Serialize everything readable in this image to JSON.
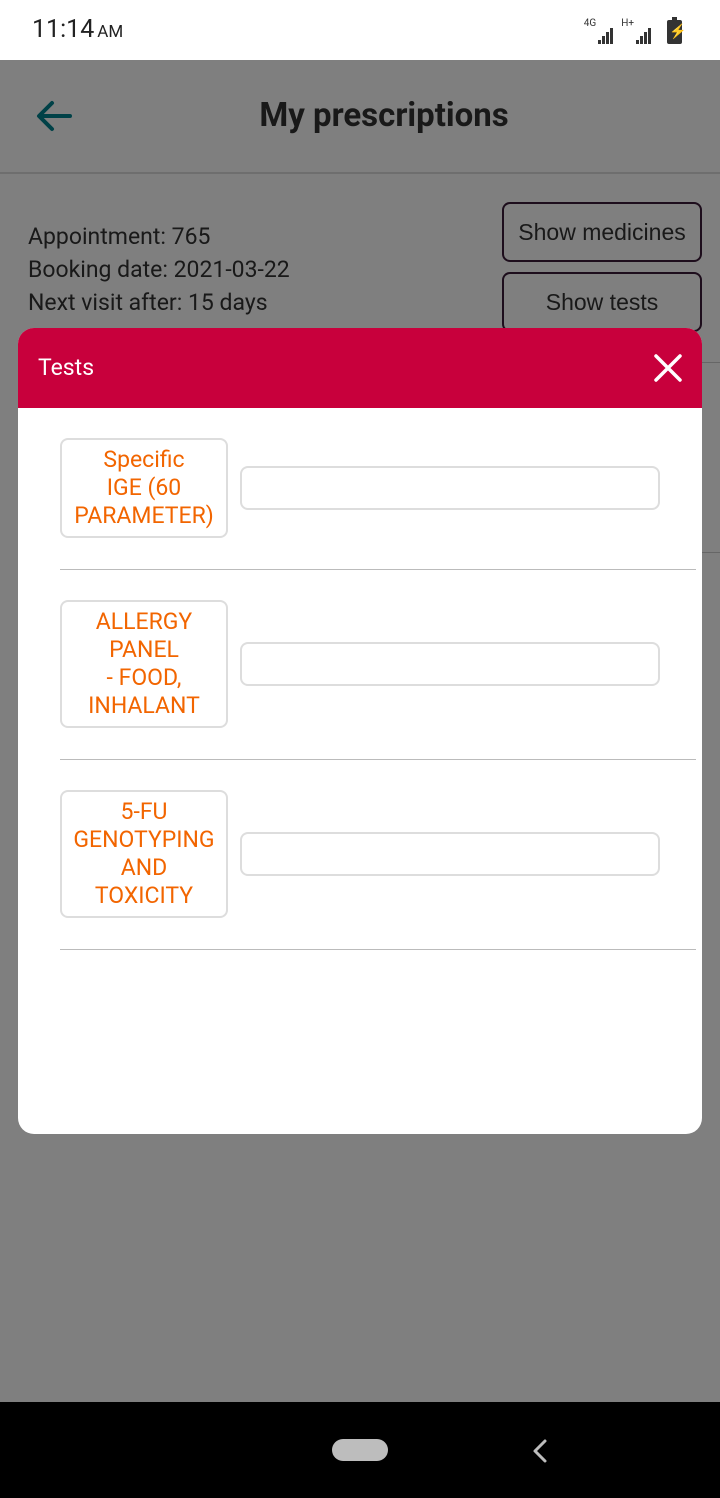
{
  "status_bar": {
    "time": "11:14",
    "ampm": "AM",
    "network_1": "4G",
    "network_2": "H+",
    "icons": [
      "signal-icon",
      "signal-icon",
      "battery-charging-icon"
    ]
  },
  "header": {
    "title": "My prescriptions",
    "back_icon": "arrow-left-icon"
  },
  "appointment": {
    "appointment_line": "Appointment: 765",
    "booking_line": "Booking date: 2021-03-22",
    "next_visit_line": "Next visit after: 15 days"
  },
  "actions": {
    "show_medicines": "Show medicines",
    "show_tests": "Show tests"
  },
  "dialog": {
    "title": "Tests",
    "close_icon": "close-icon",
    "tests": [
      {
        "name": "Specific\nIGE (60\nPARAMETER)",
        "value": ""
      },
      {
        "name": "ALLERGY\nPANEL\n- FOOD,\nINHALANT",
        "value": ""
      },
      {
        "name": "5-FU\nGENOTYPING\nAND\nTOXICITY",
        "value": ""
      }
    ]
  },
  "nav_bar": {
    "icons": [
      "home-pill-icon",
      "back-chevron-icon"
    ]
  },
  "colors": {
    "accent": "#c8003c",
    "test_text": "#f26500",
    "back_arrow": "#00838f",
    "button_border": "#3a1a38"
  }
}
